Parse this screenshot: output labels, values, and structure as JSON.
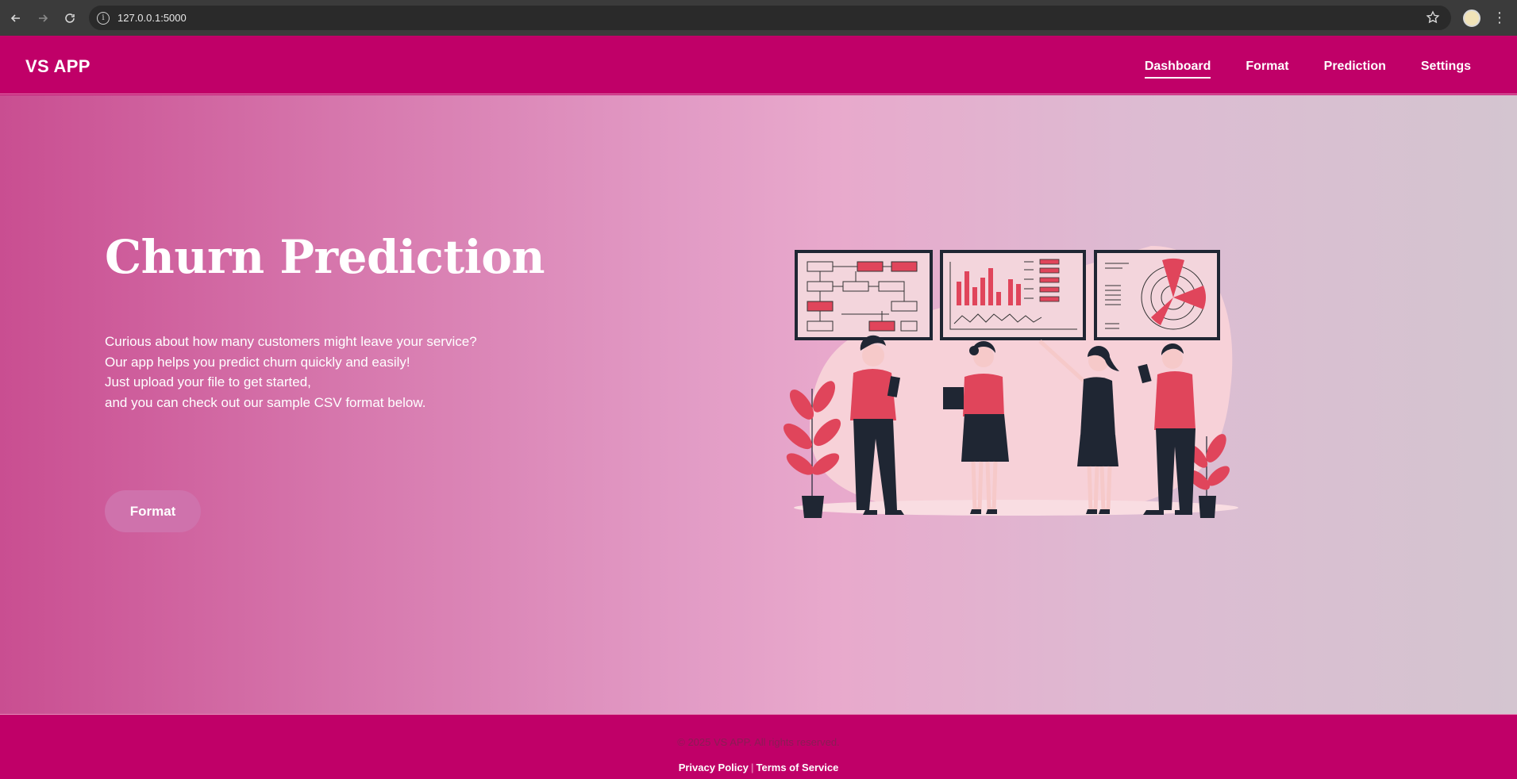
{
  "browser": {
    "url": "127.0.0.1:5000",
    "icons": [
      "back-icon",
      "forward-icon",
      "reload-icon",
      "site-info-icon",
      "bookmark-star-icon",
      "profile-avatar",
      "kebab-menu-icon"
    ]
  },
  "nav": {
    "brand": "VS APP",
    "links": [
      {
        "label": "Dashboard",
        "active": true
      },
      {
        "label": "Format",
        "active": false
      },
      {
        "label": "Prediction",
        "active": false
      },
      {
        "label": "Settings",
        "active": false
      }
    ]
  },
  "hero": {
    "title": "Churn Prediction",
    "lines": [
      "Curious about how many customers might leave your service?",
      "Our app helps you predict churn quickly and easily!",
      "Just upload your file to get started,",
      "and you can check out our sample CSV format below."
    ],
    "button_label": "Format"
  },
  "footer": {
    "copyright": "© 2025 VS APP. All rights reserved.",
    "privacy": "Privacy Policy",
    "separator": "|",
    "terms": "Terms of Service"
  },
  "colors": {
    "brand": "#c00068",
    "accent_red": "#e0455b",
    "dark": "#1f2633"
  }
}
